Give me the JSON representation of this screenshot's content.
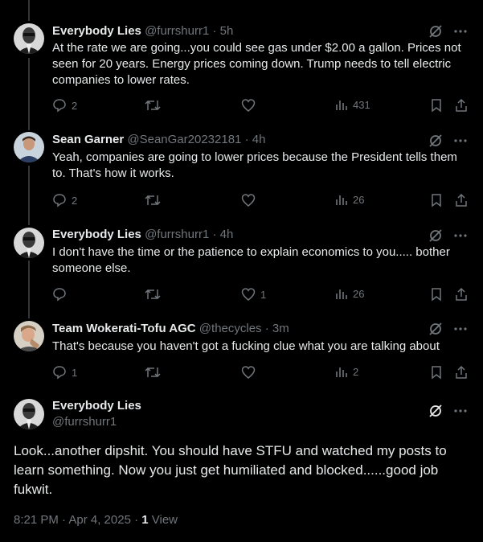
{
  "tweets": [
    {
      "name": "Everybody Lies",
      "handle": "@furrshurr1",
      "time": "5h",
      "text": "At the rate we are going...you could see gas under $2.00 a gallon.  Prices not seen for 20 years.  Energy prices coming down.  Trump needs to tell electric companies to lower rates.",
      "replies": "2",
      "likes": "",
      "views": "431"
    },
    {
      "name": "Sean Garner",
      "handle": "@SeanGar20232181",
      "time": "4h",
      "text": "Yeah, companies are going to lower prices because the President tells them to. That's how it works.",
      "replies": "2",
      "likes": "",
      "views": "26"
    },
    {
      "name": "Everybody Lies",
      "handle": "@furrshurr1",
      "time": "4h",
      "text": "I don't have the time or the patience to explain economics to you..... bother someone else.",
      "replies": "",
      "likes": "1",
      "views": "26"
    },
    {
      "name": "Team Wokerati-Tofu AGC",
      "handle": "@thecycles",
      "time": "3m",
      "text": "That's because you haven't got a fucking clue what you are talking about",
      "replies": "1",
      "likes": "",
      "views": "2"
    }
  ],
  "focus": {
    "name": "Everybody Lies",
    "handle": "@furrshurr1",
    "text": "Look...another dipshit.  You should have STFU and watched my posts to learn something.  Now you just get humiliated and blocked......good job fukwit.",
    "timestamp": "8:21 PM · Apr 4, 2025 · ",
    "view_count": "1",
    "view_label": " View"
  },
  "separator": " · ",
  "colors": {
    "background": "#000000",
    "text": "#e7e9ea",
    "muted": "#71767b",
    "thread_line": "#333639"
  }
}
